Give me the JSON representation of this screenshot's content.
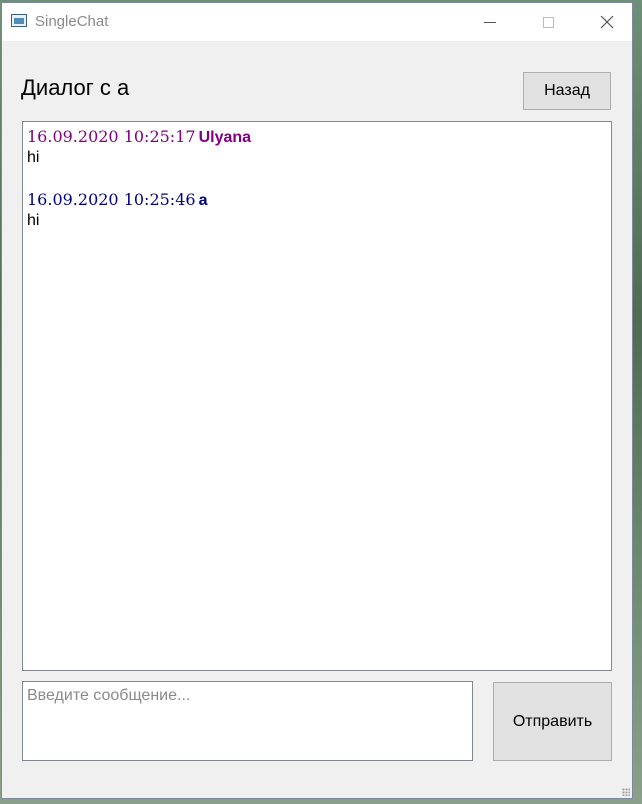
{
  "window": {
    "title": "SingleChat",
    "icon": "app-window-icon",
    "controls": [
      "minimize-icon",
      "maximize-icon",
      "close-icon"
    ]
  },
  "header": {
    "title": "Диалог с а",
    "back_label": "Назад"
  },
  "chat": {
    "messages": [
      {
        "timestamp": "16.09.2020 10:25:17",
        "author": "Ulyana",
        "text": "hi",
        "color": "#800080"
      },
      {
        "timestamp": "16.09.2020 10:25:46",
        "author": "a",
        "text": "hi",
        "color": "#000080"
      }
    ]
  },
  "composer": {
    "placeholder": "Введите сообщение...",
    "value": "",
    "send_label": "Отправить"
  }
}
